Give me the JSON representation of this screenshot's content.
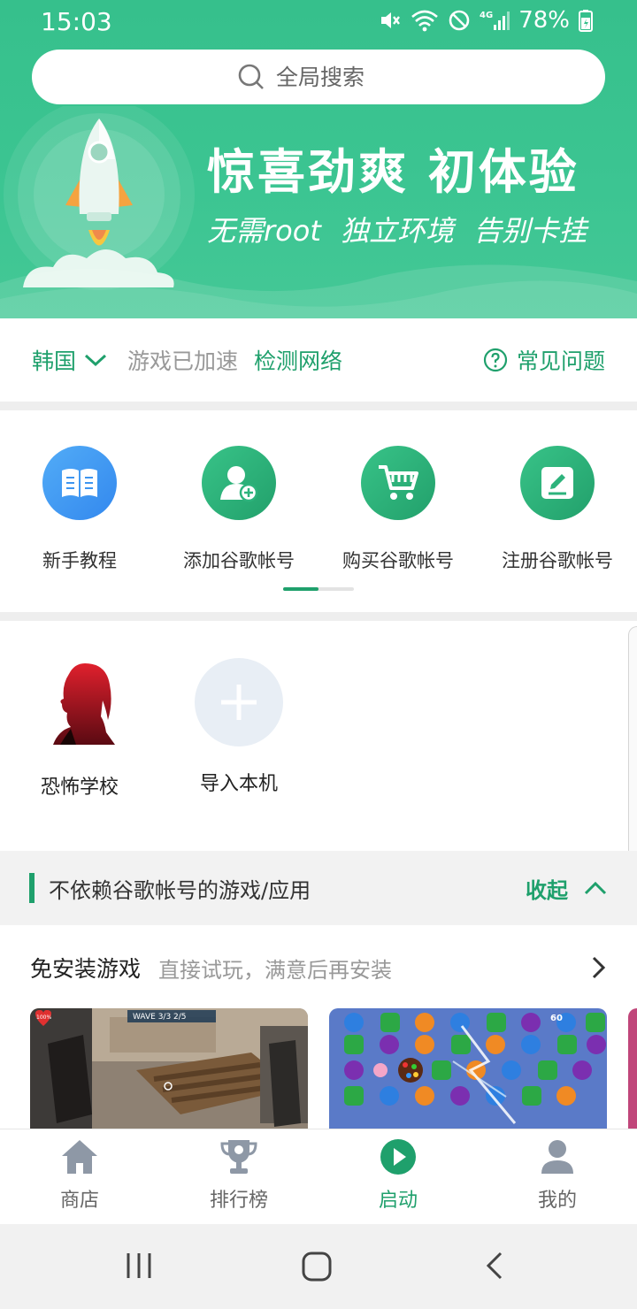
{
  "status_bar": {
    "time": "15:03",
    "battery": "78%",
    "network": "4G"
  },
  "search": {
    "placeholder": "全局搜索"
  },
  "hero": {
    "title": "惊喜劲爽  初体验",
    "subtitle": "无需root  独立环境  告别卡挂"
  },
  "network": {
    "region": "韩国",
    "status": "游戏已加速",
    "detect": "检测网络",
    "faq": "常见问题"
  },
  "quick_actions": [
    {
      "label": "新手教程",
      "icon": "book-icon",
      "color": "#3d95f0"
    },
    {
      "label": "添加谷歌帐号",
      "icon": "add-user-icon",
      "color": "#2db37c"
    },
    {
      "label": "购买谷歌帐号",
      "icon": "cart-icon",
      "color": "#2db37c"
    },
    {
      "label": "注册谷歌帐号",
      "icon": "edit-icon",
      "color": "#2db37c"
    }
  ],
  "apps": [
    {
      "label": "恐怖学校",
      "icon": "horror-school-icon"
    },
    {
      "label": "导入本机",
      "icon": "plus-icon"
    }
  ],
  "section": {
    "title": "不依赖谷歌帐号的游戏/应用",
    "collapse": "收起"
  },
  "free_install": {
    "title": "免安装游戏",
    "subtitle": "直接试玩，满意后再安装"
  },
  "game_cards": [
    {
      "badge": "100%",
      "hud": "WAVE 3/3    2/5"
    },
    {
      "badge": "60"
    }
  ],
  "bottom_nav": [
    {
      "label": "商店",
      "icon": "home-icon"
    },
    {
      "label": "排行榜",
      "icon": "trophy-icon"
    },
    {
      "label": "启动",
      "icon": "play-icon",
      "active": true
    },
    {
      "label": "我的",
      "icon": "person-icon"
    }
  ],
  "colors": {
    "brand": "#1fa06c",
    "header": "#3cc592",
    "blue": "#3d95f0"
  }
}
